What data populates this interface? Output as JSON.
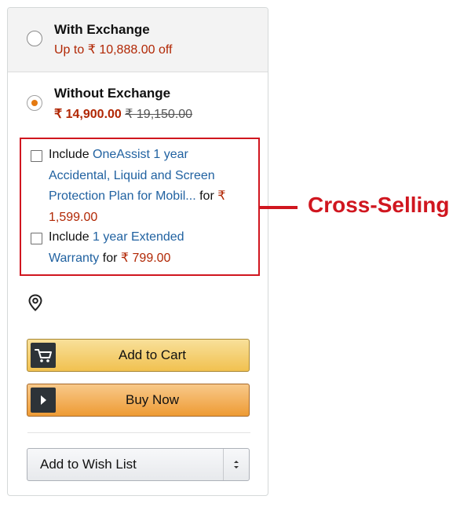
{
  "exchange_option": {
    "title": "With Exchange",
    "subtitle": "Up to ₹ 10,888.00 off",
    "selected": false
  },
  "no_exchange_option": {
    "title": "Without Exchange",
    "price": "₹ 14,900.00",
    "original_price": "₹ 19,150.00",
    "selected": true
  },
  "cross_sell": {
    "item1": {
      "include_text": "Include",
      "link_line1": "OneAssist 1 year",
      "link_line2": "Accidental, Liquid and Screen",
      "link_line3": "Protection Plan for Mobil...",
      "for_text": "for",
      "currency": "₹",
      "price": "1,599.00",
      "checked": false
    },
    "item2": {
      "include_text": "Include",
      "link_line1": "1 year Extended",
      "link_line2": "Warranty",
      "for_text": "for",
      "price": "₹ 799.00",
      "checked": false
    }
  },
  "location": {
    "icon": "location-pin-icon"
  },
  "buttons": {
    "add_to_cart": "Add to Cart",
    "buy_now": "Buy Now",
    "wish_list": "Add to Wish List"
  },
  "annotation": {
    "label": "Cross-Selling",
    "color": "#d0161f"
  },
  "colors": {
    "price_red": "#b12704",
    "link_blue": "#2162a1",
    "radio_orange": "#e47911"
  }
}
